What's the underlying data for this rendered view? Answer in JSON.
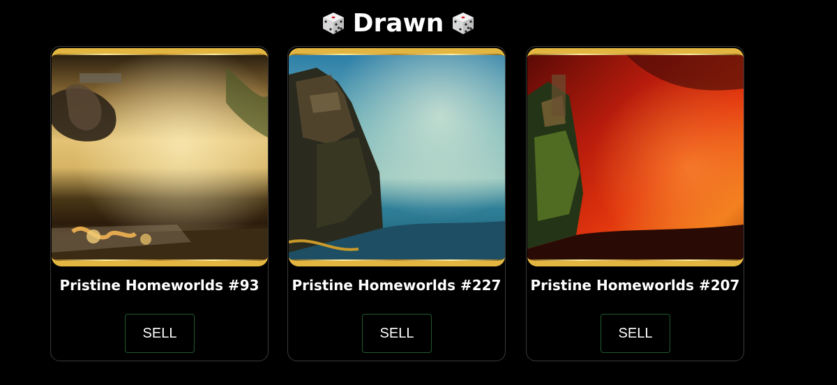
{
  "header": {
    "title": "Drawn",
    "left_icon": "dice-icon",
    "right_icon": "dice-icon"
  },
  "cards": [
    {
      "title": "Pristine Homeworlds #93",
      "button_label": "SELL",
      "art_icon": "nft-artwork-golden-fog"
    },
    {
      "title": "Pristine Homeworlds #227",
      "button_label": "SELL",
      "art_icon": "nft-artwork-teal-sea-castle"
    },
    {
      "title": "Pristine Homeworlds #207",
      "button_label": "SELL",
      "art_icon": "nft-artwork-red-fire-island"
    }
  ],
  "colors": {
    "background": "#000000",
    "card_border": "#3a3a3a",
    "frame_gold": "#e2b640",
    "button_border": "#1f5a2c",
    "text": "#ffffff"
  }
}
